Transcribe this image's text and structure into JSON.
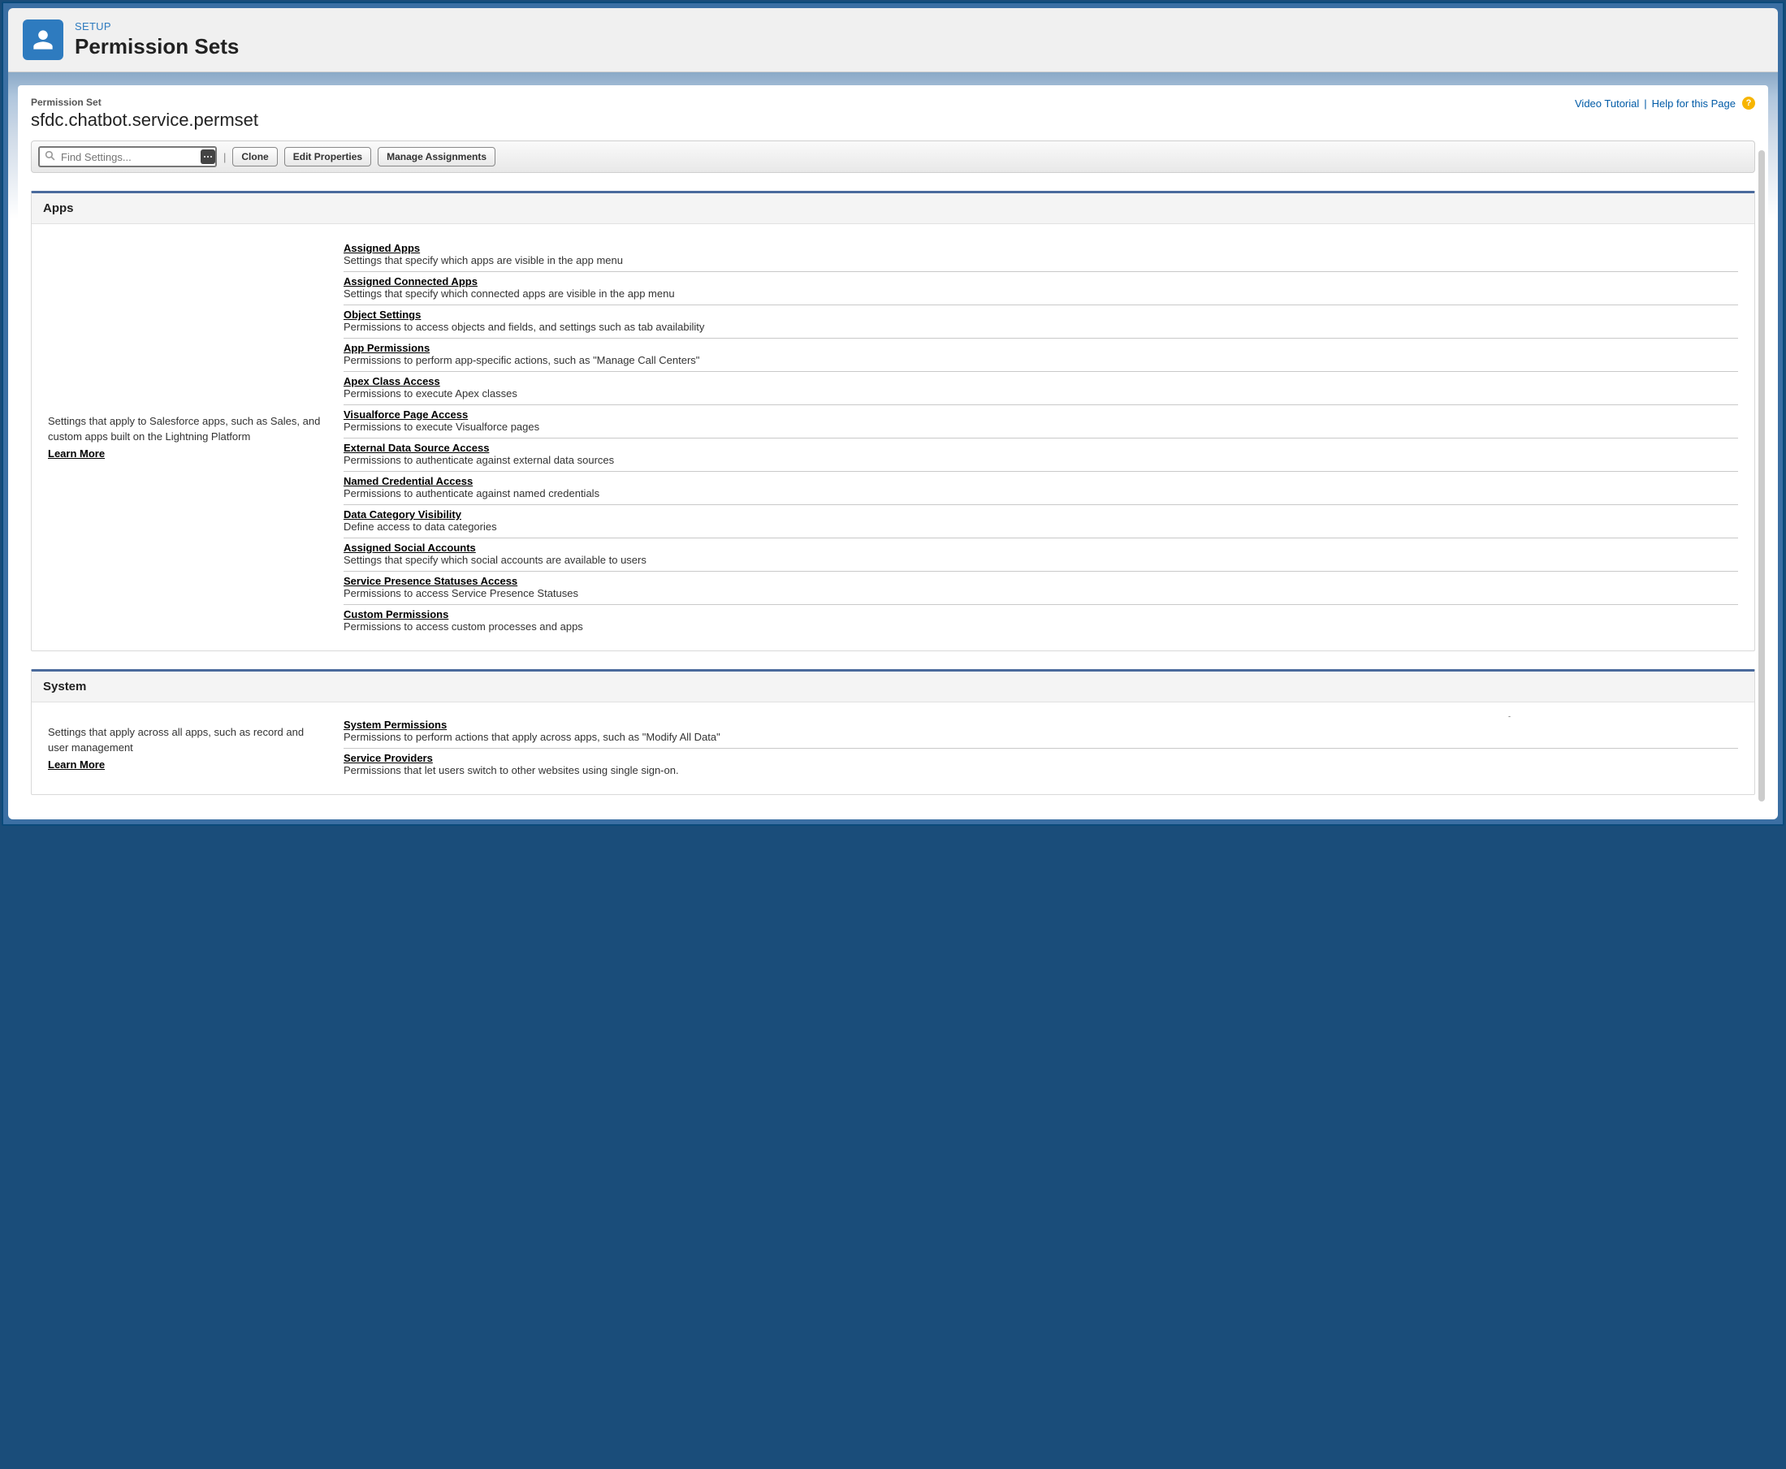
{
  "header": {
    "breadcrumb": "SETUP",
    "title": "Permission Sets"
  },
  "detail": {
    "subtype_label": "Permission Set",
    "name": "sfdc.chatbot.service.permset",
    "video_link": "Video Tutorial",
    "sep": "|",
    "help_link": "Help for this Page"
  },
  "toolbar": {
    "search_placeholder": "Find Settings...",
    "buttons": {
      "clone": "Clone",
      "edit": "Edit Properties",
      "manage": "Manage Assignments"
    }
  },
  "sections": {
    "apps": {
      "heading": "Apps",
      "intro": "Settings that apply to Salesforce apps, such as Sales, and custom apps built on the Lightning Platform",
      "learn_more": "Learn More",
      "items": [
        {
          "title": "Assigned Apps",
          "desc": "Settings that specify which apps are visible in the app menu"
        },
        {
          "title": "Assigned Connected Apps",
          "desc": "Settings that specify which connected apps are visible in the app menu"
        },
        {
          "title": "Object Settings",
          "desc": "Permissions to access objects and fields, and settings such as tab availability"
        },
        {
          "title": "App Permissions",
          "desc": "Permissions to perform app-specific actions, such as \"Manage Call Centers\""
        },
        {
          "title": "Apex Class Access",
          "desc": "Permissions to execute Apex classes"
        },
        {
          "title": "Visualforce Page Access",
          "desc": "Permissions to execute Visualforce pages"
        },
        {
          "title": "External Data Source Access",
          "desc": "Permissions to authenticate against external data sources"
        },
        {
          "title": "Named Credential Access",
          "desc": "Permissions to authenticate against named credentials"
        },
        {
          "title": "Data Category Visibility",
          "desc": "Define access to data categories"
        },
        {
          "title": "Assigned Social Accounts",
          "desc": "Settings that specify which social accounts are available to users"
        },
        {
          "title": "Service Presence Statuses Access",
          "desc": "Permissions to access Service Presence Statuses"
        },
        {
          "title": "Custom Permissions",
          "desc": "Permissions to access custom processes and apps"
        }
      ]
    },
    "system": {
      "heading": "System",
      "intro": "Settings that apply across all apps, such as record and user management",
      "learn_more": "Learn More",
      "items": [
        {
          "title": "System Permissions",
          "desc": "Permissions to perform actions that apply across apps, such as \"Modify All Data\""
        },
        {
          "title": "Service Providers",
          "desc": "Permissions that let users switch to other websites using single sign-on."
        }
      ]
    }
  }
}
